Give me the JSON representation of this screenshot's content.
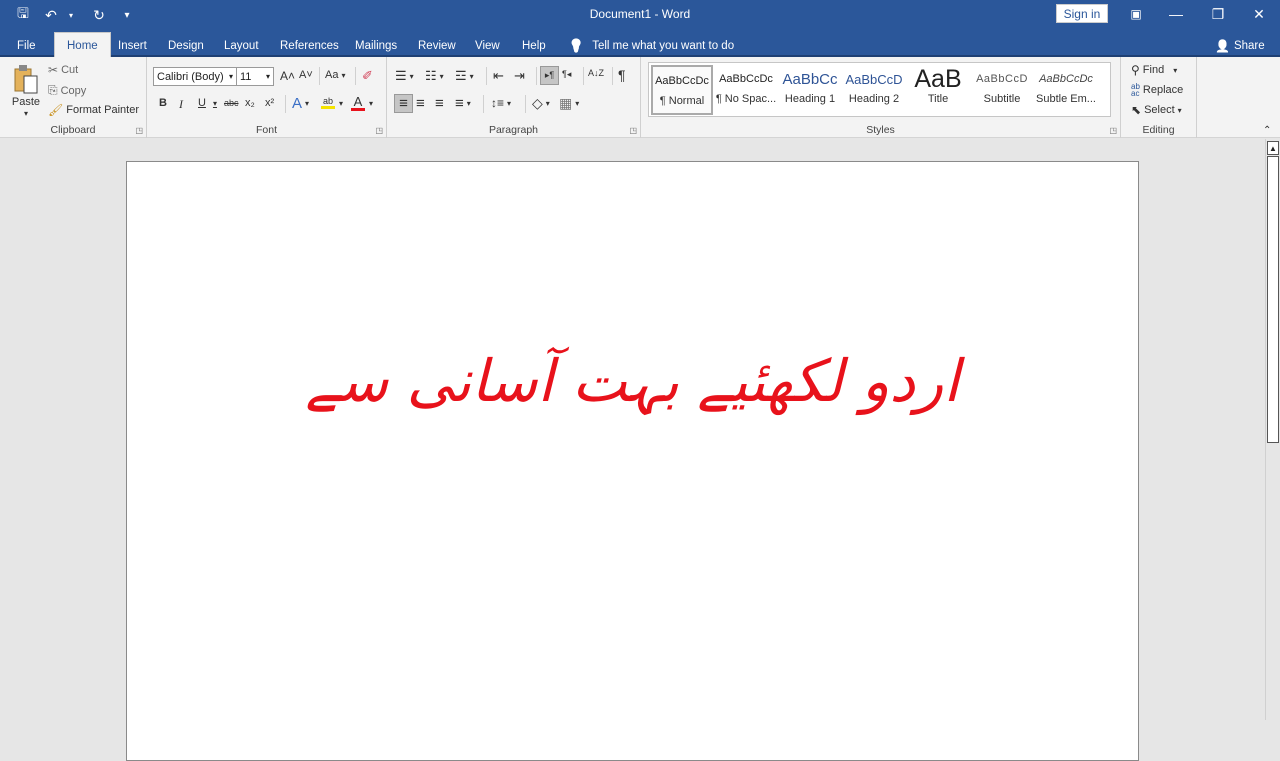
{
  "window": {
    "title": "Document1  -  Word",
    "sign_in": "Sign in",
    "qat": {
      "save_icon": "save-icon",
      "undo_icon": "undo-icon",
      "redo_icon": "repeat-icon",
      "customize_icon": "customize-qat-icon"
    },
    "icons": {
      "save": "🖫",
      "undo": "↶",
      "dropdown": "▾",
      "redo": "↻",
      "customize": "⩸",
      "ribbon_display": "▣",
      "minimize": "—",
      "restore": "❐",
      "close": "✕"
    }
  },
  "tabs": [
    {
      "label": "File",
      "active": false
    },
    {
      "label": "Home",
      "active": true
    },
    {
      "label": "Insert",
      "active": false
    },
    {
      "label": "Design",
      "active": false
    },
    {
      "label": "Layout",
      "active": false
    },
    {
      "label": "References",
      "active": false
    },
    {
      "label": "Mailings",
      "active": false
    },
    {
      "label": "Review",
      "active": false
    },
    {
      "label": "View",
      "active": false
    },
    {
      "label": "Help",
      "active": false
    }
  ],
  "tell_me": {
    "icon": "💡",
    "text": "Tell me what you want to do"
  },
  "share": {
    "icon": "👤",
    "label": "Share"
  },
  "clipboard": {
    "label": "Clipboard",
    "paste": "Paste",
    "cut": "Cut",
    "copy": "Copy",
    "format_painter": "Format Painter"
  },
  "font": {
    "label": "Font",
    "family": "Calibri (Body)",
    "size": "11",
    "grow": "A˄",
    "shrink": "A˅",
    "change_case": "Aa",
    "clear": "⌫",
    "bold": "B",
    "italic": "I",
    "underline": "U",
    "strike": "abc",
    "subscript": "x₂",
    "superscript": "x²",
    "text_effects": "A",
    "highlight": "ab",
    "font_color": "A",
    "highlight_color": "#f5e400",
    "font_color_value": "#e8121b"
  },
  "paragraph": {
    "label": "Paragraph",
    "bullets": "☰",
    "numbering": "☷",
    "multilevel": "☲",
    "decrease_indent": "⇤",
    "increase_indent": "⇥",
    "ltr": "▸¶",
    "rtl": "¶◂",
    "sort": "A↓Z",
    "show_marks": "¶",
    "align_left": "≡",
    "center": "≡",
    "align_right": "≡",
    "justify": "≡",
    "line_spacing": "↕≡",
    "shading": "◇",
    "borders": "▦"
  },
  "styles": {
    "label": "Styles",
    "items": [
      {
        "preview": "AaBbCcDc",
        "name": "¶ Normal",
        "selected": true
      },
      {
        "preview": "AaBbCcDc",
        "name": "¶ No Spac...",
        "selected": false
      },
      {
        "preview": "AaBbCc",
        "name": "Heading 1",
        "selected": false
      },
      {
        "preview": "AaBbCcD",
        "name": "Heading 2",
        "selected": false
      },
      {
        "preview": "AaB",
        "name": "Title",
        "selected": false
      },
      {
        "preview": "AaBbCcD",
        "name": "Subtitle",
        "selected": false
      },
      {
        "preview": "AaBbCcDc",
        "name": "Subtle Em...",
        "selected": false
      }
    ]
  },
  "editing": {
    "label": "Editing",
    "find": "Find",
    "replace": "Replace",
    "select": "Select"
  },
  "document": {
    "text": "اردو لکھئیے بہت آسانی سے",
    "text_color": "#e8121b"
  },
  "colors": {
    "accent": "#2b579a",
    "ribbon_bg": "#f3f3f3",
    "workspace_bg": "#e6e6e6"
  }
}
